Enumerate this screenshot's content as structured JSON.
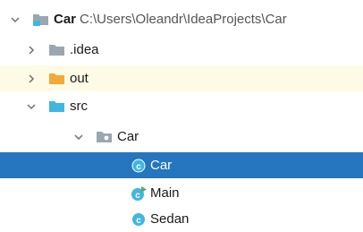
{
  "tree": {
    "root": {
      "label": "Car",
      "path": "C:\\Users\\Oleandr\\IdeaProjects\\Car"
    },
    "idea": {
      "label": ".idea"
    },
    "out": {
      "label": "out"
    },
    "src": {
      "label": "src"
    },
    "package": {
      "label": "Car"
    },
    "classes": [
      {
        "label": "Car",
        "icon": "class-icon",
        "selected": true
      },
      {
        "label": "Main",
        "icon": "runnable-class-icon"
      },
      {
        "label": "Sedan",
        "icon": "class-icon"
      }
    ]
  },
  "colors": {
    "selection": "#2675bf",
    "highlight_row": "#fdfbe5",
    "folder_gray": "#9aa7b0",
    "folder_orange": "#f4a937",
    "folder_blue": "#40b6e0",
    "class_blue": "#40b6e0",
    "run_green": "#59a869"
  }
}
